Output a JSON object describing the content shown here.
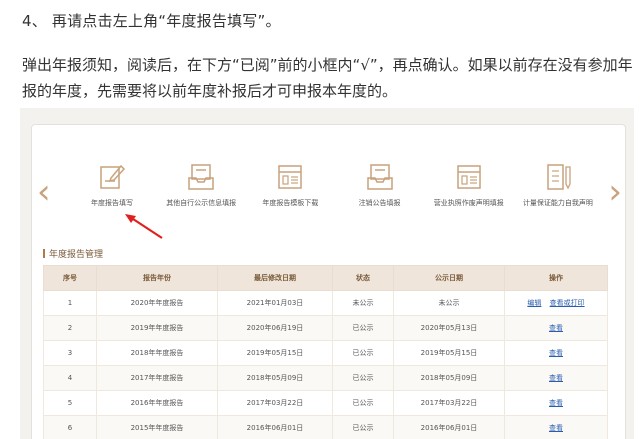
{
  "step": "4、  再请点击左上角“年度报告填写”。",
  "paragraph": "弹出年报须知，阅读后，在下方“已阅”前的小框内“√”，再点确认。如果以前存在没有参加年报的年度，先需要将以前年度补报后才可申报本年度的。",
  "nav": {
    "prev": "‹",
    "next": "›"
  },
  "icons": [
    {
      "label": "年度报告填写",
      "icon": "edit-document-icon"
    },
    {
      "label": "其他自行公示信息填报",
      "icon": "inbox-tray-icon"
    },
    {
      "label": "年度报告模板下载",
      "icon": "template-form-icon"
    },
    {
      "label": "注销公告填报",
      "icon": "inbox-tray-icon"
    },
    {
      "label": "营业执照作废声明填报",
      "icon": "template-form-icon"
    },
    {
      "label": "计量保证能力自我声明",
      "icon": "checklist-pen-icon"
    }
  ],
  "section_title": "年度报告管理",
  "table": {
    "headers": [
      "序号",
      "报告年份",
      "最后修改日期",
      "状态",
      "公示日期",
      "操作"
    ],
    "rows": [
      {
        "no": "1",
        "year": "2020年年度报告",
        "modified": "2021年01月03日",
        "status": "未公示",
        "published": "未公示",
        "actions": [
          "编辑",
          "查看或打印"
        ]
      },
      {
        "no": "2",
        "year": "2019年年度报告",
        "modified": "2020年06月19日",
        "status": "已公示",
        "published": "2020年05月13日",
        "actions": [
          "查看"
        ]
      },
      {
        "no": "3",
        "year": "2018年年度报告",
        "modified": "2019年05月15日",
        "status": "已公示",
        "published": "2019年05月15日",
        "actions": [
          "查看"
        ]
      },
      {
        "no": "4",
        "year": "2017年年度报告",
        "modified": "2018年05月09日",
        "status": "已公示",
        "published": "2018年05月09日",
        "actions": [
          "查看"
        ]
      },
      {
        "no": "5",
        "year": "2016年年度报告",
        "modified": "2017年03月22日",
        "status": "已公示",
        "published": "2017年03月22日",
        "actions": [
          "查看"
        ]
      },
      {
        "no": "6",
        "year": "2015年年度报告",
        "modified": "2016年06月01日",
        "status": "已公示",
        "published": "2016年06月01日",
        "actions": [
          "查看"
        ]
      }
    ]
  },
  "colors": {
    "accent": "#c8a27c",
    "header_bg": "#efe5da",
    "link": "#2a5db0",
    "annotation_arrow": "#e02020"
  }
}
